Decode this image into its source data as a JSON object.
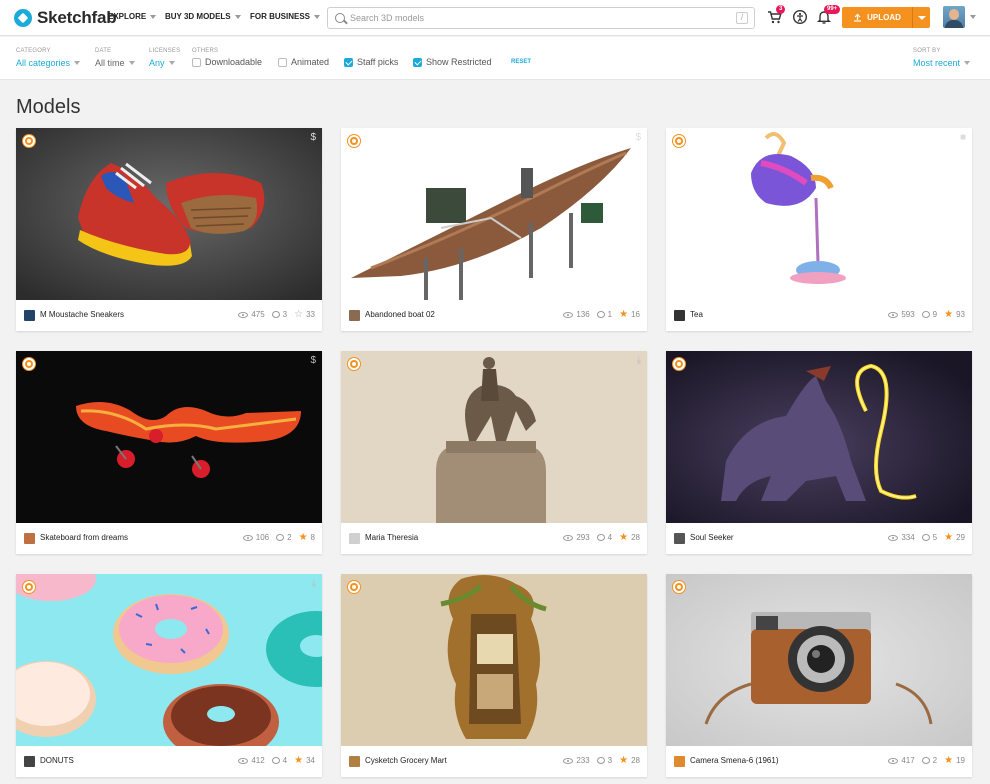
{
  "header": {
    "logo_text": "Sketchfab",
    "nav": {
      "explore": "EXPLORE",
      "buy": "BUY 3D MODELS",
      "business": "FOR BUSINESS"
    },
    "search_placeholder": "Search 3D models",
    "search_shortcut": "/",
    "cart_count": "3",
    "notifications_count": "99+",
    "upload_label": "UPLOAD"
  },
  "filters": {
    "category": {
      "label": "CATEGORY",
      "value": "All categories"
    },
    "date": {
      "label": "DATE",
      "value": "All time"
    },
    "licenses": {
      "label": "LICENSES",
      "value": "Any"
    },
    "others_label": "OTHERS",
    "checkboxes": [
      {
        "label": "Downloadable",
        "checked": false
      },
      {
        "label": "Animated",
        "checked": false
      },
      {
        "label": "Staff picks",
        "checked": true
      },
      {
        "label": "Show Restricted",
        "checked": true
      }
    ],
    "reset": "RESET",
    "sort": {
      "label": "SORT BY",
      "value": "Most recent"
    }
  },
  "page_title": "Models",
  "models": [
    {
      "name": "M Moustache Sneakers",
      "views": "475",
      "comments": "3",
      "likes": "33",
      "liked": false,
      "staff_pick": true,
      "corner": "$",
      "icon": "sneakers-thumbnail"
    },
    {
      "name": "Abandoned boat 02",
      "views": "136",
      "comments": "1",
      "likes": "16",
      "liked": true,
      "staff_pick": true,
      "corner": "$",
      "icon": "boat-thumbnail"
    },
    {
      "name": "Tea",
      "views": "593",
      "comments": "9",
      "likes": "93",
      "liked": true,
      "staff_pick": true,
      "corner": "■",
      "icon": "teapot-thumbnail"
    },
    {
      "name": "Skateboard from dreams",
      "views": "106",
      "comments": "2",
      "likes": "8",
      "liked": true,
      "staff_pick": true,
      "corner": "$",
      "icon": "skateboard-thumbnail"
    },
    {
      "name": "Maria Theresia",
      "views": "293",
      "comments": "4",
      "likes": "28",
      "liked": true,
      "staff_pick": true,
      "corner": "⤓",
      "icon": "statue-thumbnail"
    },
    {
      "name": "Soul Seeker",
      "views": "334",
      "comments": "5",
      "likes": "29",
      "liked": true,
      "staff_pick": true,
      "corner": "",
      "icon": "creature-thumbnail"
    },
    {
      "name": "DONUTS",
      "views": "412",
      "comments": "4",
      "likes": "34",
      "liked": true,
      "staff_pick": true,
      "corner": "⤓",
      "icon": "donuts-thumbnail"
    },
    {
      "name": "Cysketch Grocery Mart",
      "views": "233",
      "comments": "3",
      "likes": "28",
      "liked": true,
      "staff_pick": true,
      "corner": "",
      "icon": "tree-house-thumbnail"
    },
    {
      "name": "Camera Smena-6 (1961)",
      "views": "417",
      "comments": "2",
      "likes": "19",
      "liked": true,
      "staff_pick": true,
      "corner": "",
      "icon": "camera-thumbnail"
    }
  ]
}
